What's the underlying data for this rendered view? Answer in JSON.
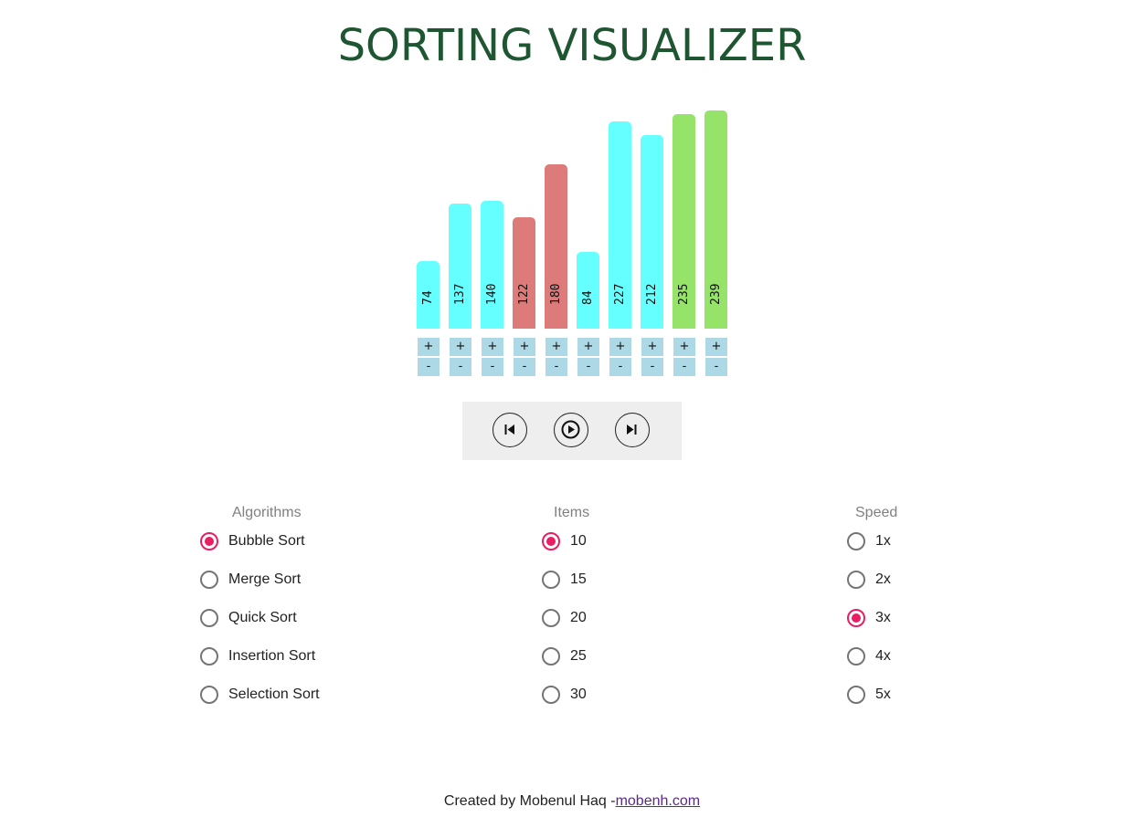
{
  "title": "SORTING VISUALIZER",
  "colors": {
    "title": "#1e5631",
    "bar_default": "#66ffff",
    "bar_comparing": "#dd7b7b",
    "bar_sorted": "#96e36a",
    "stepper_bg": "#add8e6",
    "radio_selected": "#e91e63"
  },
  "chart_data": {
    "type": "bar",
    "values": [
      74,
      137,
      140,
      122,
      180,
      84,
      227,
      212,
      235,
      239
    ],
    "states": [
      "default",
      "default",
      "default",
      "comparing",
      "comparing",
      "default",
      "default",
      "default",
      "sorted",
      "sorted"
    ]
  },
  "steppers": {
    "plus_label": "+",
    "minus_label": "-"
  },
  "controls": {
    "previous_icon": "skip-previous-icon",
    "play_icon": "play-icon",
    "next_icon": "skip-next-icon"
  },
  "algorithms": {
    "title": "Algorithms",
    "selected": "Bubble Sort",
    "options": [
      "Bubble Sort",
      "Merge Sort",
      "Quick Sort",
      "Insertion Sort",
      "Selection Sort"
    ]
  },
  "items": {
    "title": "Items",
    "selected": "10",
    "options": [
      "10",
      "15",
      "20",
      "25",
      "30"
    ]
  },
  "speed": {
    "title": "Speed",
    "selected": "3x",
    "options": [
      "1x",
      "2x",
      "3x",
      "4x",
      "5x"
    ]
  },
  "footer": {
    "text": "Created by Mobenul Haq -",
    "link_text": "mobenh.com"
  }
}
